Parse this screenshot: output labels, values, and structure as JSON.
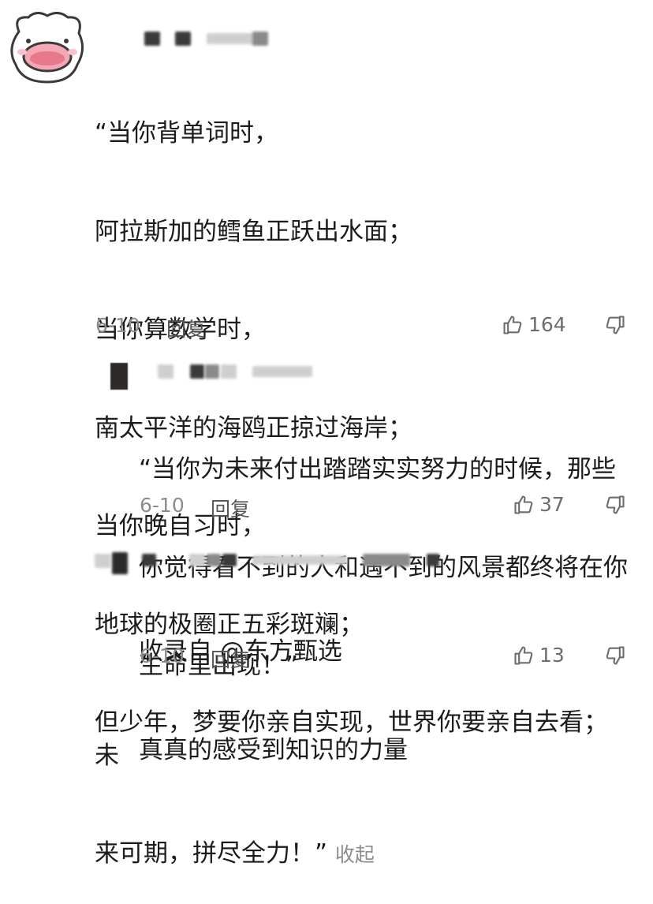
{
  "comments": [
    {
      "body_lines": [
        "“当你背单词时，",
        "阿拉斯加的鳕鱼正跃出水面；",
        "当你算数学时，",
        "南太平洋的海鸥正掠过海岸；",
        "当你晚自习时，",
        "地球的极圈正五彩斑斓；",
        "但少年，梦要你亲自实现，世界你要亲自去看；  未",
        "来可期，拼尽全力！”"
      ],
      "collapse_label": "收起",
      "date": "6-10",
      "reply_label": "回复",
      "likes": "164"
    },
    {
      "body_lines": [
        "“当你为未来付出踏踏实实努力的时候，那些",
        "你觉得看不到的人和遇不到的风景都终将在你",
        "生命里出现！”"
      ],
      "date": "6-10",
      "reply_label": "回复",
      "likes": "37"
    },
    {
      "body_lines": [
        "收录自 @东方甄选",
        "真真的感受到知识的力量"
      ],
      "date": "6-10",
      "reply_label": "回复",
      "likes": "13"
    }
  ],
  "icons": {
    "like": "thumbs-up-icon",
    "dislike": "thumbs-down-icon",
    "avatar": "pig-face-avatar"
  },
  "colors": {
    "text": "#1c1c1c",
    "meta": "#8c8c8c",
    "avatar_pink": "#f4a7b5"
  }
}
